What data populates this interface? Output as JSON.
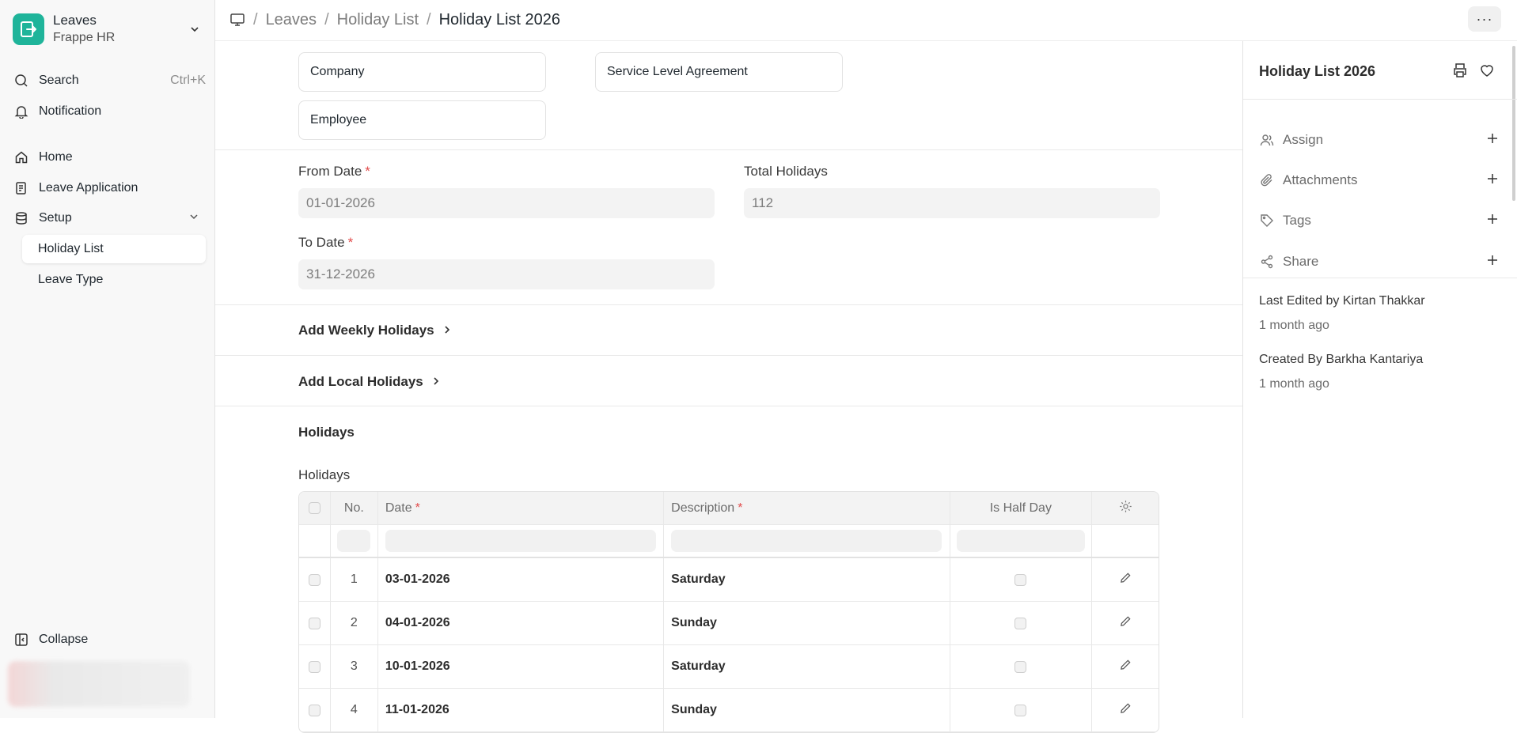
{
  "app": {
    "name": "Leaves",
    "workspace": "Frappe HR"
  },
  "sidebar": {
    "search": {
      "label": "Search",
      "shortcut": "Ctrl+K"
    },
    "notification": "Notification",
    "items": [
      {
        "label": "Home",
        "icon": "home-icon"
      },
      {
        "label": "Leave Application",
        "icon": "document-icon"
      },
      {
        "label": "Setup",
        "icon": "database-icon"
      }
    ],
    "sub_items": [
      {
        "label": "Holiday List",
        "active": true
      },
      {
        "label": "Leave Type",
        "active": false
      }
    ],
    "collapse": "Collapse"
  },
  "breadcrumb": {
    "items": [
      "Leaves",
      "Holiday List"
    ],
    "current": "Holiday List 2026"
  },
  "form": {
    "link_fields": {
      "company": "Company",
      "sla": "Service Level Agreement",
      "employee": "Employee"
    },
    "from_date": {
      "label": "From Date",
      "value": "01-01-2026"
    },
    "total_holidays": {
      "label": "Total Holidays",
      "value": "112"
    },
    "to_date": {
      "label": "To Date",
      "value": "31-12-2026"
    },
    "add_weekly": "Add Weekly Holidays",
    "add_local": "Add Local Holidays",
    "holidays_section": "Holidays",
    "holidays_table_label": "Holidays"
  },
  "table": {
    "columns": {
      "no": "No.",
      "date": "Date",
      "description": "Description",
      "half_day": "Is Half Day"
    },
    "rows": [
      {
        "no": "1",
        "date": "03-01-2026",
        "description": "Saturday"
      },
      {
        "no": "2",
        "date": "04-01-2026",
        "description": "Sunday"
      },
      {
        "no": "3",
        "date": "10-01-2026",
        "description": "Saturday"
      },
      {
        "no": "4",
        "date": "11-01-2026",
        "description": "Sunday"
      }
    ]
  },
  "right_panel": {
    "title": "Holiday List 2026",
    "actions": [
      "Assign",
      "Attachments",
      "Tags",
      "Share"
    ],
    "last_edited": "Last Edited by Kirtan Thakkar",
    "last_edited_time": "1 month ago",
    "created_by": "Created By Barkha Kantariya",
    "created_time": "1 month ago"
  },
  "colors": {
    "brand": "#1fb49a",
    "required": "#e24c4c"
  }
}
